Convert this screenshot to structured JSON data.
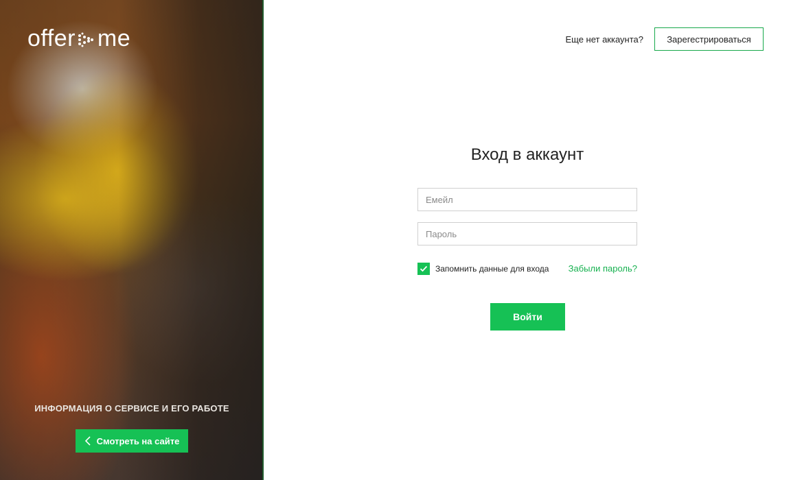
{
  "brand": {
    "logo_left": "offer",
    "logo_right": "me",
    "accent": "#16c155"
  },
  "left_panel": {
    "info_text": "ИНФОРМАЦИЯ О СЕРВИСЕ И ЕГО РАБОТЕ",
    "view_site_label": "Смотреть на сайте",
    "view_site_icon": "chevron-left-icon"
  },
  "header": {
    "no_account_text": "Еще нет аккаунта?",
    "register_label": "Зарегестрироваться"
  },
  "login_form": {
    "title": "Вход в аккаунт",
    "email": {
      "value": "",
      "placeholder": "Емейл"
    },
    "password": {
      "value": "",
      "placeholder": "Пароль"
    },
    "remember": {
      "label": "Запомнить данные для входа",
      "checked": true,
      "icon": "check-icon"
    },
    "forgot_label": "Забыли пароль?",
    "submit_label": "Войти"
  }
}
